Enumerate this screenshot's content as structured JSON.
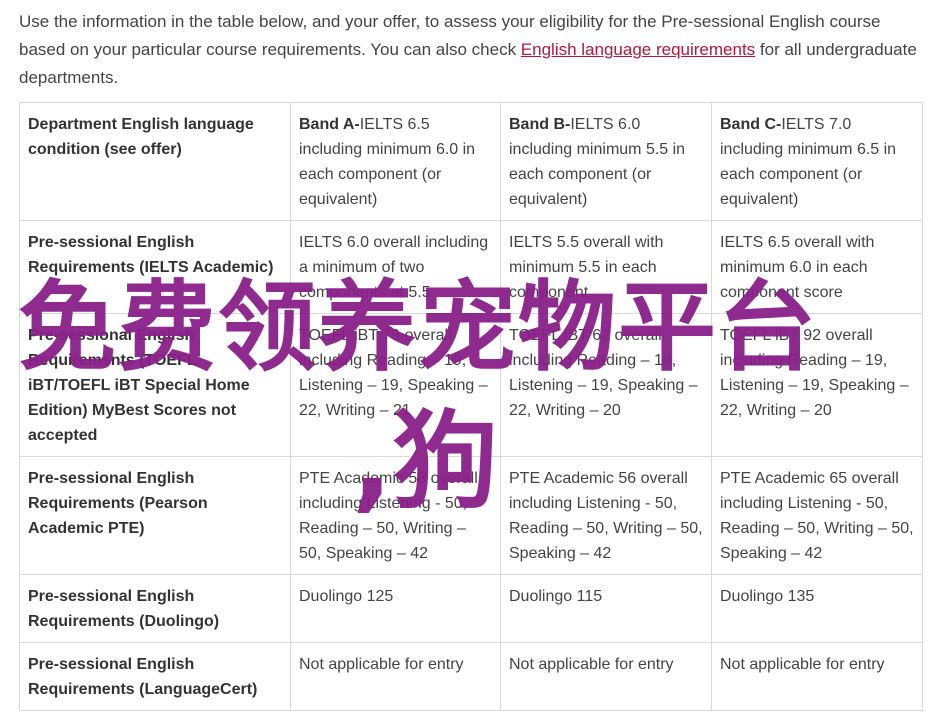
{
  "intro": {
    "text_before": "Use the information in the table below, and your offer, to assess your eligibility for the Pre-sessional English course based on your particular course requirements. You can also check ",
    "link": "English language requirements",
    "text_after": " for all undergraduate departments."
  },
  "table": {
    "rows": [
      {
        "head": "Department English language condition (see offer)",
        "cells": [
          {
            "band": "Band A-",
            "rest": "IELTS 6.5 including minimum 6.0 in each component (or equivalent)"
          },
          {
            "band": "Band B-",
            "rest": "IELTS 6.0 including minimum 5.5 in each component (or equivalent)"
          },
          {
            "band": "Band C-",
            "rest": "IELTS 7.0 including minimum 6.5 in each component (or equivalent)"
          }
        ]
      },
      {
        "head": "Pre-sessional English Requirements (IELTS Academic)",
        "cells": [
          {
            "text": "IELTS 6.0 overall including a minimum of two components at 5.5"
          },
          {
            "text": "IELTS 5.5 overall with minimum 5.5 in each component"
          },
          {
            "text": "IELTS 6.5 overall with minimum 6.0 in each component score"
          }
        ]
      },
      {
        "head": "Pre-sessional English Requirements (TOEFL iBT/TOEFL iBT Special Home Edition) MyBest Scores not accepted",
        "cells": [
          {
            "text": "TOEFL iBT 79 overall including Reading – 19, Listening – 19, Speaking – 22, Writing – 21"
          },
          {
            "text": "TOEFL iBT 62 overall including Reading – 19, Listening – 19, Speaking – 22, Writing – 20"
          },
          {
            "text": "TOEFL iBT 92 overall including Reading – 19, Listening – 19, Speaking – 22, Writing – 20"
          }
        ]
      },
      {
        "head": "Pre-sessional English Requirements (Pearson Academic PTE)",
        "cells": [
          {
            "text": "PTE Academic 58 overall including Listening - 50, Reading – 50, Writing – 50, Speaking – 42"
          },
          {
            "text": "PTE Academic 56 overall including Listening - 50, Reading – 50, Writing – 50, Speaking – 42"
          },
          {
            "text": "PTE Academic 65 overall including Listening - 50, Reading – 50, Writing – 50, Speaking – 42"
          }
        ]
      },
      {
        "head": "Pre-sessional English Requirements (Duolingo)",
        "cells": [
          {
            "text": "Duolingo 125"
          },
          {
            "text": "Duolingo 115"
          },
          {
            "text": "Duolingo 135"
          }
        ]
      },
      {
        "head": "Pre-sessional English Requirements (LanguageCert)",
        "cells": [
          {
            "text": "Not applicable for entry"
          },
          {
            "text": "Not applicable for entry"
          },
          {
            "text": "Not applicable for entry"
          }
        ]
      }
    ]
  },
  "watermark": {
    "line1": "免费领养宠物平台",
    "line2": ",狗",
    "color": "#8a1f8a"
  },
  "colors": {
    "link": "#b3173a",
    "text": "#444444",
    "border": "#d9d9d9"
  }
}
